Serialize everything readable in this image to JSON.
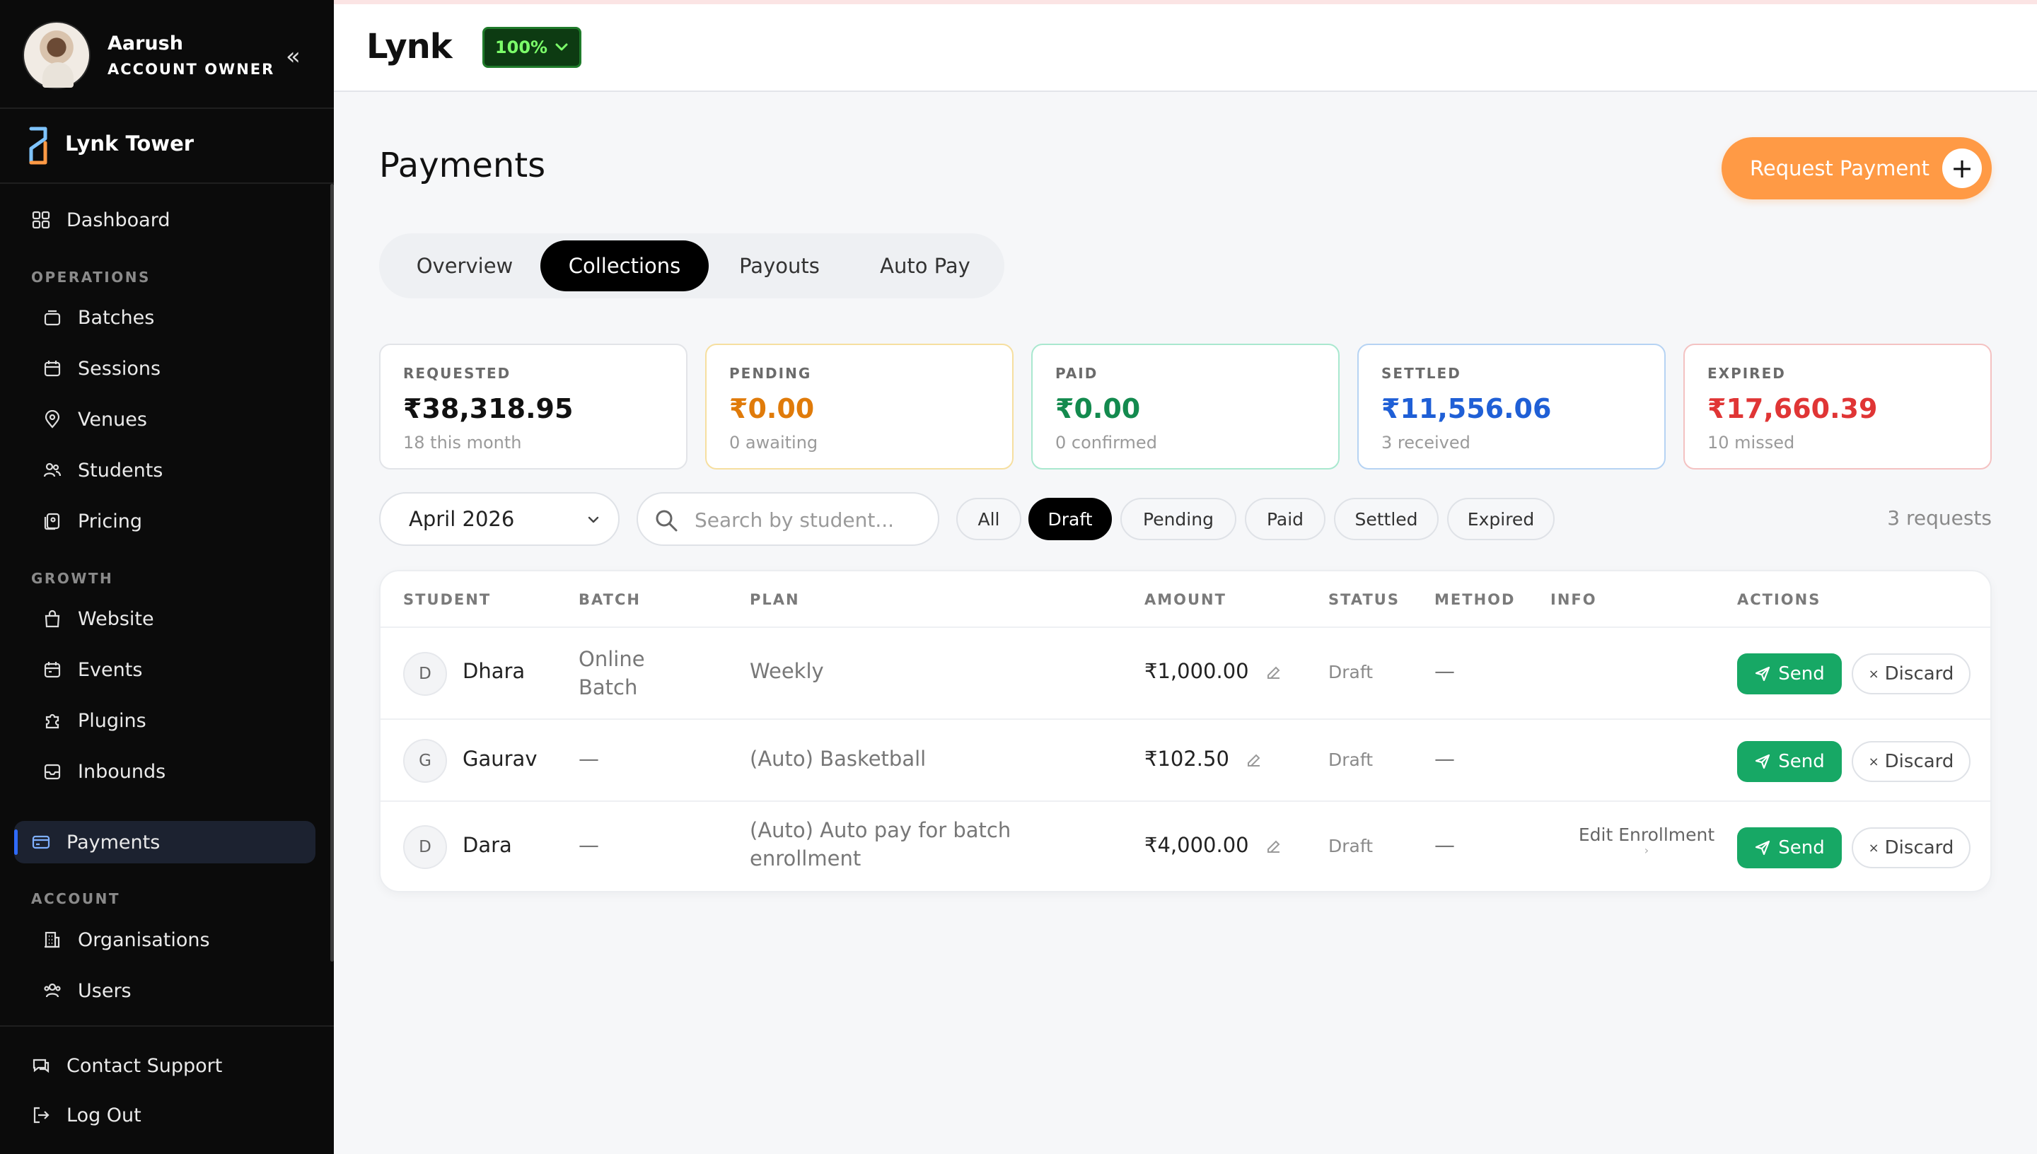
{
  "sidebar": {
    "profile": {
      "name": "Aarush",
      "role": "ACCOUNT OWNER"
    },
    "org": {
      "name": "Lynk Tower"
    },
    "items": {
      "dashboard": "Dashboard",
      "section_operations": "OPERATIONS",
      "batches": "Batches",
      "sessions": "Sessions",
      "venues": "Venues",
      "students": "Students",
      "pricing": "Pricing",
      "section_growth": "GROWTH",
      "website": "Website",
      "events": "Events",
      "plugins": "Plugins",
      "inbounds": "Inbounds",
      "payments": "Payments",
      "section_account": "ACCOUNT",
      "organisations": "Organisations",
      "users": "Users",
      "contact_support": "Contact Support",
      "log_out": "Log Out"
    }
  },
  "topbar": {
    "brand": "Lynk",
    "progress_label": "100%",
    "progress_value": 100
  },
  "page": {
    "title": "Payments",
    "request_button": "Request Payment",
    "tabs": [
      "Overview",
      "Collections",
      "Payouts",
      "Auto Pay"
    ],
    "active_tab": "Collections"
  },
  "stats": [
    {
      "label": "REQUESTED",
      "value": "₹38,318.95",
      "sub": "18 this month",
      "color": "#111111",
      "border": "#e2e4e8"
    },
    {
      "label": "PENDING",
      "value": "₹0.00",
      "sub": "0 awaiting",
      "color": "#e07b0a",
      "border": "#f6dfa0"
    },
    {
      "label": "PAID",
      "value": "₹0.00",
      "sub": "0 confirmed",
      "color": "#138a4e",
      "border": "#a9e8cf"
    },
    {
      "label": "SETTLED",
      "value": "₹11,556.06",
      "sub": "3 received",
      "color": "#1f5fd6",
      "border": "#b6d3f3"
    },
    {
      "label": "EXPIRED",
      "value": "₹17,660.39",
      "sub": "10 missed",
      "color": "#e03535",
      "border": "#f4c2c2"
    }
  ],
  "filters": {
    "month": "April 2026",
    "search_placeholder": "Search by student...",
    "chips": [
      "All",
      "Draft",
      "Pending",
      "Paid",
      "Settled",
      "Expired"
    ],
    "active_chip": "Draft",
    "count": "3 requests"
  },
  "table": {
    "headers": [
      "STUDENT",
      "BATCH",
      "PLAN",
      "AMOUNT",
      "STATUS",
      "METHOD",
      "INFO",
      "ACTIONS"
    ],
    "rows": [
      {
        "initial": "D",
        "student": "Dhara",
        "batch": "Online Batch",
        "plan": "Weekly",
        "amount": "₹1,000.00",
        "status": "Draft",
        "method": "—",
        "info": ""
      },
      {
        "initial": "G",
        "student": "Gaurav",
        "batch": "—",
        "plan": "(Auto) Basketball",
        "amount": "₹102.50",
        "status": "Draft",
        "method": "—",
        "info": ""
      },
      {
        "initial": "D",
        "student": "Dara",
        "batch": "—",
        "plan": "(Auto) Auto pay for batch enrollment",
        "amount": "₹4,000.00",
        "status": "Draft",
        "method": "—",
        "info": "Edit Enrollment"
      }
    ],
    "send_label": "Send",
    "discard_label": "Discard"
  }
}
